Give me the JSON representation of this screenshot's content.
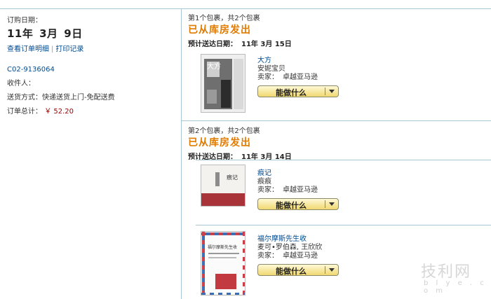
{
  "order": {
    "date_label": "订购日期：",
    "date_year": "11年",
    "date_month": "3月",
    "date_day": "9日",
    "link_details": "查看订单明细",
    "link_sep": "|",
    "link_print": "打印记录",
    "order_number": "C02-9136064",
    "recipient_label": "收件人：",
    "shipping_label": "送货方式：",
    "shipping_value": "快递送货上门-免配送费",
    "total_label": "订单总计：",
    "total_value": "￥ 52.20"
  },
  "packages": [
    {
      "count": "第1个包裹，共2个包裹",
      "status": "已从库房发出",
      "eta_label": "预计送达日期：",
      "eta_value": "11年 3月 15日",
      "items": [
        {
          "title": "大方",
          "author": "安妮宝贝",
          "seller_label": "卖家：",
          "seller": "卓越亚马逊",
          "button": "能做什么",
          "cover_text": "大方"
        }
      ]
    },
    {
      "count": "第2个包裹，共2个包裹",
      "status": "已从库房发出",
      "eta_label": "预计送达日期：",
      "eta_value": "11年 3月 14日",
      "items": [
        {
          "title": "痕记",
          "author": "痕痕",
          "seller_label": "卖家：",
          "seller": "卓越亚马逊",
          "button": "能做什么",
          "cover_text": "痕记"
        },
        {
          "title": "福尔摩斯先生收",
          "author": "麦可•罗伯森, 王欣欣",
          "seller_label": "卖家：",
          "seller": "卓越亚马逊",
          "button": "能做什么",
          "cover_text": "福尔摩斯先生收"
        }
      ]
    }
  ],
  "watermark": {
    "main": "技利网",
    "sub": "b l y e . c o m"
  }
}
